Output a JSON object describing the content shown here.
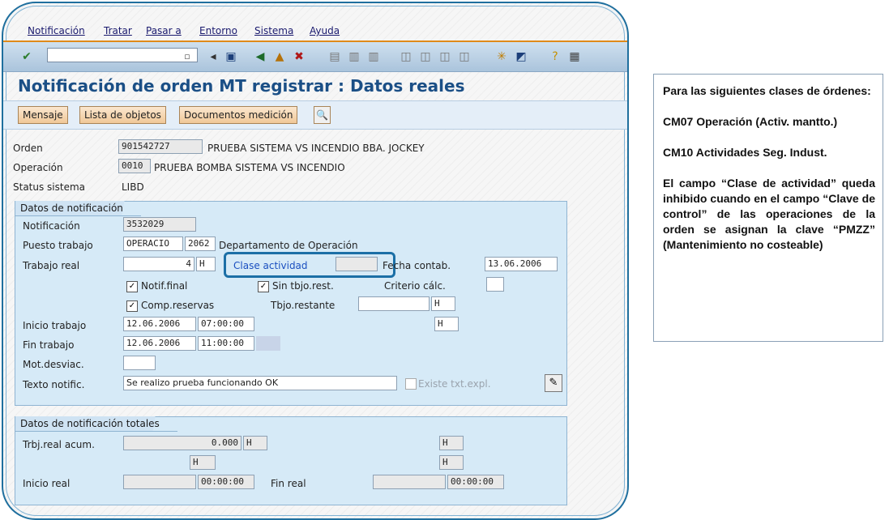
{
  "menu": {
    "items": [
      "Notificación",
      "Tratar",
      "Pasar a",
      "Entorno",
      "Sistema",
      "Ayuda"
    ]
  },
  "toolbar": {
    "command_value": ""
  },
  "page": {
    "title": "Notificación de orden MT registrar : Datos reales"
  },
  "app_buttons": {
    "mensaje": "Mensaje",
    "lista_objetos": "Lista de objetos",
    "documentos_medicion": "Documentos medición"
  },
  "header": {
    "orden_label": "Orden",
    "orden_value": "901542727",
    "orden_text": "PRUEBA SISTEMA VS INCENDIO BBA. JOCKEY",
    "operacion_label": "Operación",
    "operacion_value": "0010",
    "operacion_text": "PRUEBA BOMBA SISTEMA VS INCENDIO",
    "status_label": "Status sistema",
    "status_value": "LIBD"
  },
  "notif": {
    "group_title": "Datos de notificación",
    "notificacion_label": "Notificación",
    "notificacion_value": "3532029",
    "puesto_label": "Puesto trabajo",
    "puesto_value": "OPERACIO",
    "puesto_num": "2062",
    "puesto_text": "Departamento de Operación",
    "trabajo_real_label": "Trabajo real",
    "trabajo_real_value": "4",
    "trabajo_real_unit": "H",
    "clase_actividad_label": "Clase actividad",
    "clase_actividad_value": "",
    "fecha_contab_label": "Fecha contab.",
    "fecha_contab_value": "13.06.2006",
    "notif_final_label": "Notif.final",
    "sin_tbjo_label": "Sin tbjo.rest.",
    "criterio_label": "Criterio cálc.",
    "comp_reservas_label": "Comp.reservas",
    "tbjo_restante_label": "Tbjo.restante",
    "tbjo_restante_unit": "H",
    "extra_unit": "H",
    "inicio_label": "Inicio trabajo",
    "inicio_fecha": "12.06.2006",
    "inicio_hora": "07:00:00",
    "fin_label": "Fin trabajo",
    "fin_fecha": "12.06.2006",
    "fin_hora": "11:00:00",
    "mot_label": "Mot.desviac.",
    "texto_label": "Texto notific.",
    "texto_value": "Se realizo prueba funcionando OK",
    "existe_label": "Existe txt.expl."
  },
  "totales": {
    "group_title": "Datos de notificación totales",
    "trbj_label": "Trbj.real acum.",
    "trbj_value": "0.000",
    "trbj_unit": "H",
    "unit_a": "H",
    "unit_b": "H",
    "unit_c": "H",
    "inicio_label": "Inicio real",
    "inicio_hora": "00:00:00",
    "fin_label": "Fin real",
    "fin_hora": "00:00:00"
  },
  "note": {
    "p1": "Para las siguientes clases de órdenes:",
    "p2": "CM07 Operación (Activ. mantto.)",
    "p3": "CM10  Actividades Seg. Indust.",
    "p4": "El campo “Clase de actividad” queda inhibido cuando en el campo “Clave de control” de las operaciones de la orden se asignan la clave “PMZZ” (Mantenimiento no costeable)"
  }
}
